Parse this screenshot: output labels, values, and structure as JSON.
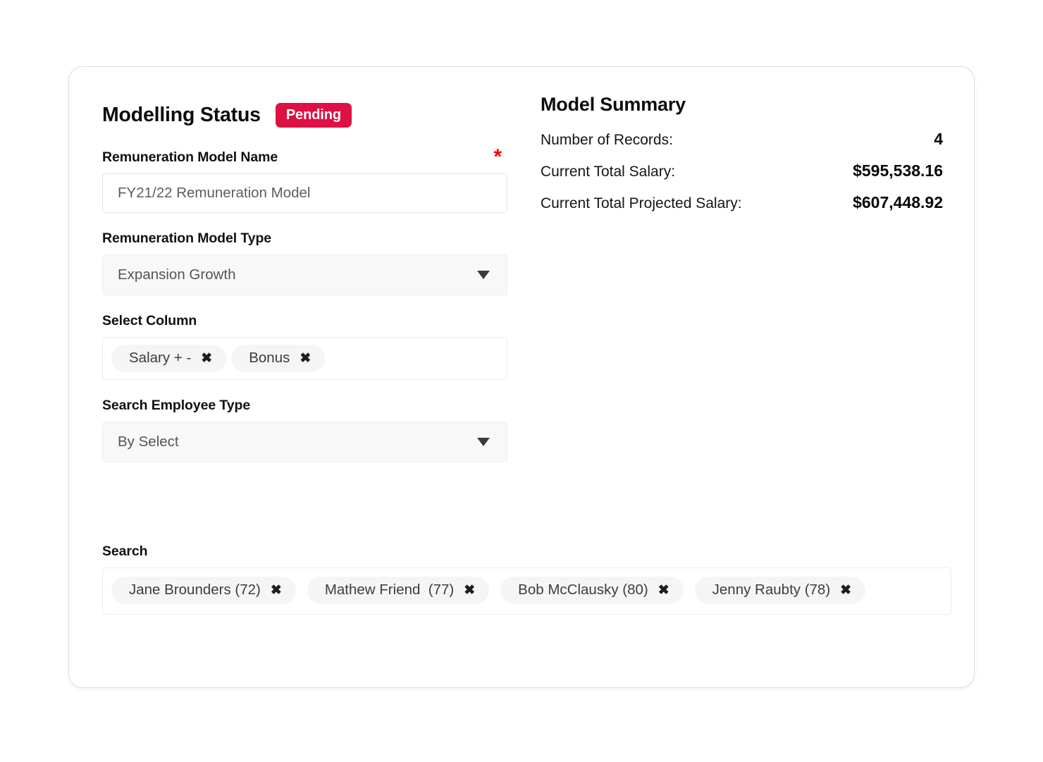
{
  "status": {
    "title": "Modelling Status",
    "badge": "Pending",
    "badge_color": "#dd1144"
  },
  "fields": {
    "model_name": {
      "label": "Remuneration Model Name",
      "required_marker": "*",
      "required_color": "#ff0000",
      "value": "FY21/22 Remuneration Model",
      "placeholder": "FY21/22 Remuneration Model"
    },
    "model_type": {
      "label": "Remuneration Model Type",
      "value": "Expansion Growth"
    },
    "select_column": {
      "label": "Select Column",
      "chips": [
        {
          "text": "Salary + -",
          "remove": "✖"
        },
        {
          "text": "Bonus",
          "remove": "✖"
        }
      ]
    },
    "employee_type": {
      "label": "Search Employee Type",
      "value": "By Select"
    },
    "search": {
      "label": "Search",
      "chips": [
        {
          "text": "Jane Brounders (72)",
          "remove": "✖"
        },
        {
          "text": "Mathew Friend  (77)",
          "remove": "✖"
        },
        {
          "text": "Bob McClausky (80)",
          "remove": "✖"
        },
        {
          "text": "Jenny Raubty (78)",
          "remove": "✖"
        }
      ]
    }
  },
  "summary": {
    "title": "Model Summary",
    "rows": [
      {
        "label": "Number of Records:",
        "value": "4"
      },
      {
        "label": "Current Total Salary:",
        "value": "$595,538.16"
      },
      {
        "label": "Current Total Projected Salary:",
        "value": "$607,448.92"
      }
    ]
  }
}
